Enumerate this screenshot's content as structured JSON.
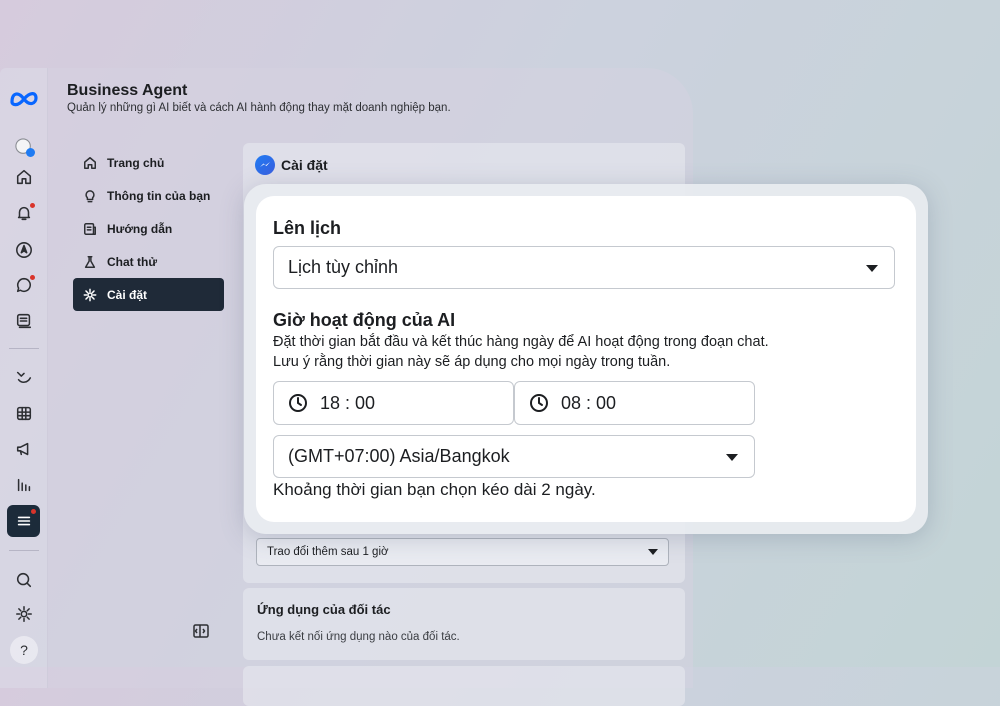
{
  "header": {
    "title": "Business Agent",
    "subtitle": "Quản lý những gì AI biết và cách AI hành động thay mặt doanh nghiệp bạn."
  },
  "rail": {
    "icons": [
      "meta-logo-icon",
      "profile-avatar-icon",
      "home-icon",
      "bell-icon",
      "compass-icon",
      "chat-bubble-icon",
      "pages-icon",
      "analytics-wave-icon",
      "calendar-grid-icon",
      "megaphone-icon",
      "bar-chart-icon",
      "menu-icon",
      "search-icon",
      "settings-icon",
      "help-icon"
    ],
    "help_label": "?"
  },
  "nav": {
    "items": [
      {
        "label": "Trang chủ",
        "icon": "home-icon"
      },
      {
        "label": "Thông tin của bạn",
        "icon": "lightbulb-icon"
      },
      {
        "label": "Hướng dẫn",
        "icon": "guide-icon"
      },
      {
        "label": "Chat thử",
        "icon": "flask-icon"
      },
      {
        "label": "Cài đặt",
        "icon": "gear-icon",
        "active": true
      }
    ]
  },
  "settings": {
    "title": "Cài đặt",
    "handoff_select": "Trao đổi thêm sau 1 giờ"
  },
  "partner": {
    "title": "Ứng dụng của đối tác",
    "text": "Chưa kết nối ứng dụng nào của đối tác."
  },
  "popup": {
    "schedule_label": "Lên lịch",
    "schedule_value": "Lịch tùy chỉnh",
    "hours_label": "Giờ hoạt động của AI",
    "hours_desc": "Đặt thời gian bắt đầu và kết thúc hàng ngày để AI hoạt động trong đoạn chat. Lưu ý rằng thời gian này sẽ áp dụng cho mọi ngày trong tuần.",
    "start_time": "18 : 00",
    "end_time": "08 : 00",
    "timezone": "(GMT+07:00) Asia/Bangkok",
    "duration_note": "Khoảng thời gian bạn chọn kéo dài 2 ngày."
  },
  "colors": {
    "active_nav_bg": "#1f2a38",
    "messenger_blue": "#1f7bf2",
    "notification_dot": "#d9342b"
  }
}
